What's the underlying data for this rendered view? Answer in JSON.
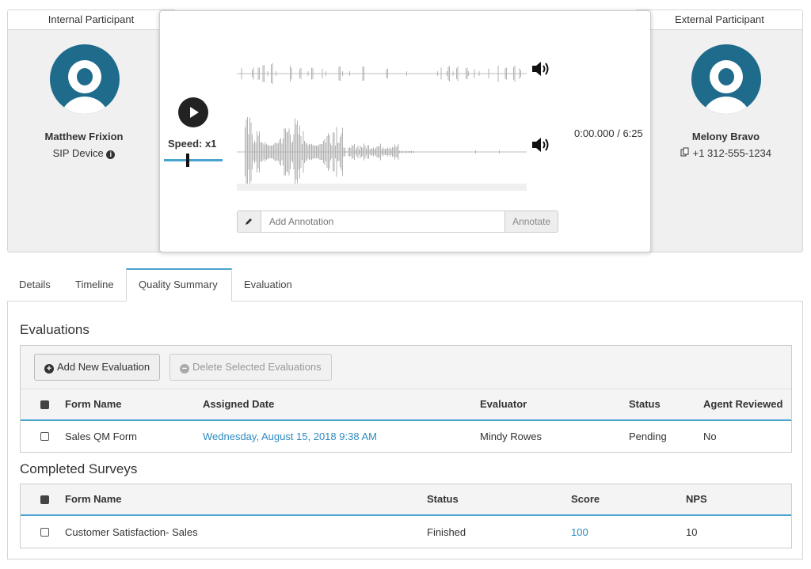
{
  "internal": {
    "title": "Internal Participant",
    "name": "Matthew Frixion",
    "device": "SIP Device"
  },
  "external": {
    "title": "External Participant",
    "name": "Melony Bravo",
    "phone": "+1 312-555-1234"
  },
  "player": {
    "speed_label": "Speed: x1",
    "time": "0:00.000 / 6:25",
    "annotation_placeholder": "Add Annotation",
    "annotate_label": "Annotate"
  },
  "tabs": [
    {
      "label": "Details"
    },
    {
      "label": "Timeline"
    },
    {
      "label": "Quality Summary"
    },
    {
      "label": "Evaluation"
    }
  ],
  "active_tab": "Quality Summary",
  "evaluations": {
    "title": "Evaluations",
    "add_label": "Add New Evaluation",
    "delete_label": "Delete Selected Evaluations",
    "columns": [
      "Form Name",
      "Assigned Date",
      "Evaluator",
      "Status",
      "Agent Reviewed"
    ],
    "rows": [
      {
        "form_name": "Sales QM Form",
        "assigned_date": "Wednesday, August 15, 2018 9:38 AM",
        "evaluator": "Mindy Rowes",
        "status": "Pending",
        "agent_reviewed": "No"
      }
    ]
  },
  "surveys": {
    "title": "Completed Surveys",
    "columns": [
      "Form Name",
      "Status",
      "Score",
      "NPS"
    ],
    "rows": [
      {
        "form_name": "Customer Satisfaction- Sales",
        "status": "Finished",
        "score": "100",
        "nps": "10"
      }
    ]
  },
  "colors": {
    "accent": "#4aa3cf",
    "link": "#2e8bc0",
    "avatar": "#1f6b8c",
    "add_icon": "#333333",
    "delete_icon": "#aaaaaa"
  },
  "icons": {
    "info": "info-circle-icon",
    "phone": "copy-phone-icon",
    "play": "play-icon",
    "volume": "volume-icon",
    "pencil": "pencil-icon",
    "add": "plus-circle-icon",
    "delete": "minus-circle-icon"
  }
}
